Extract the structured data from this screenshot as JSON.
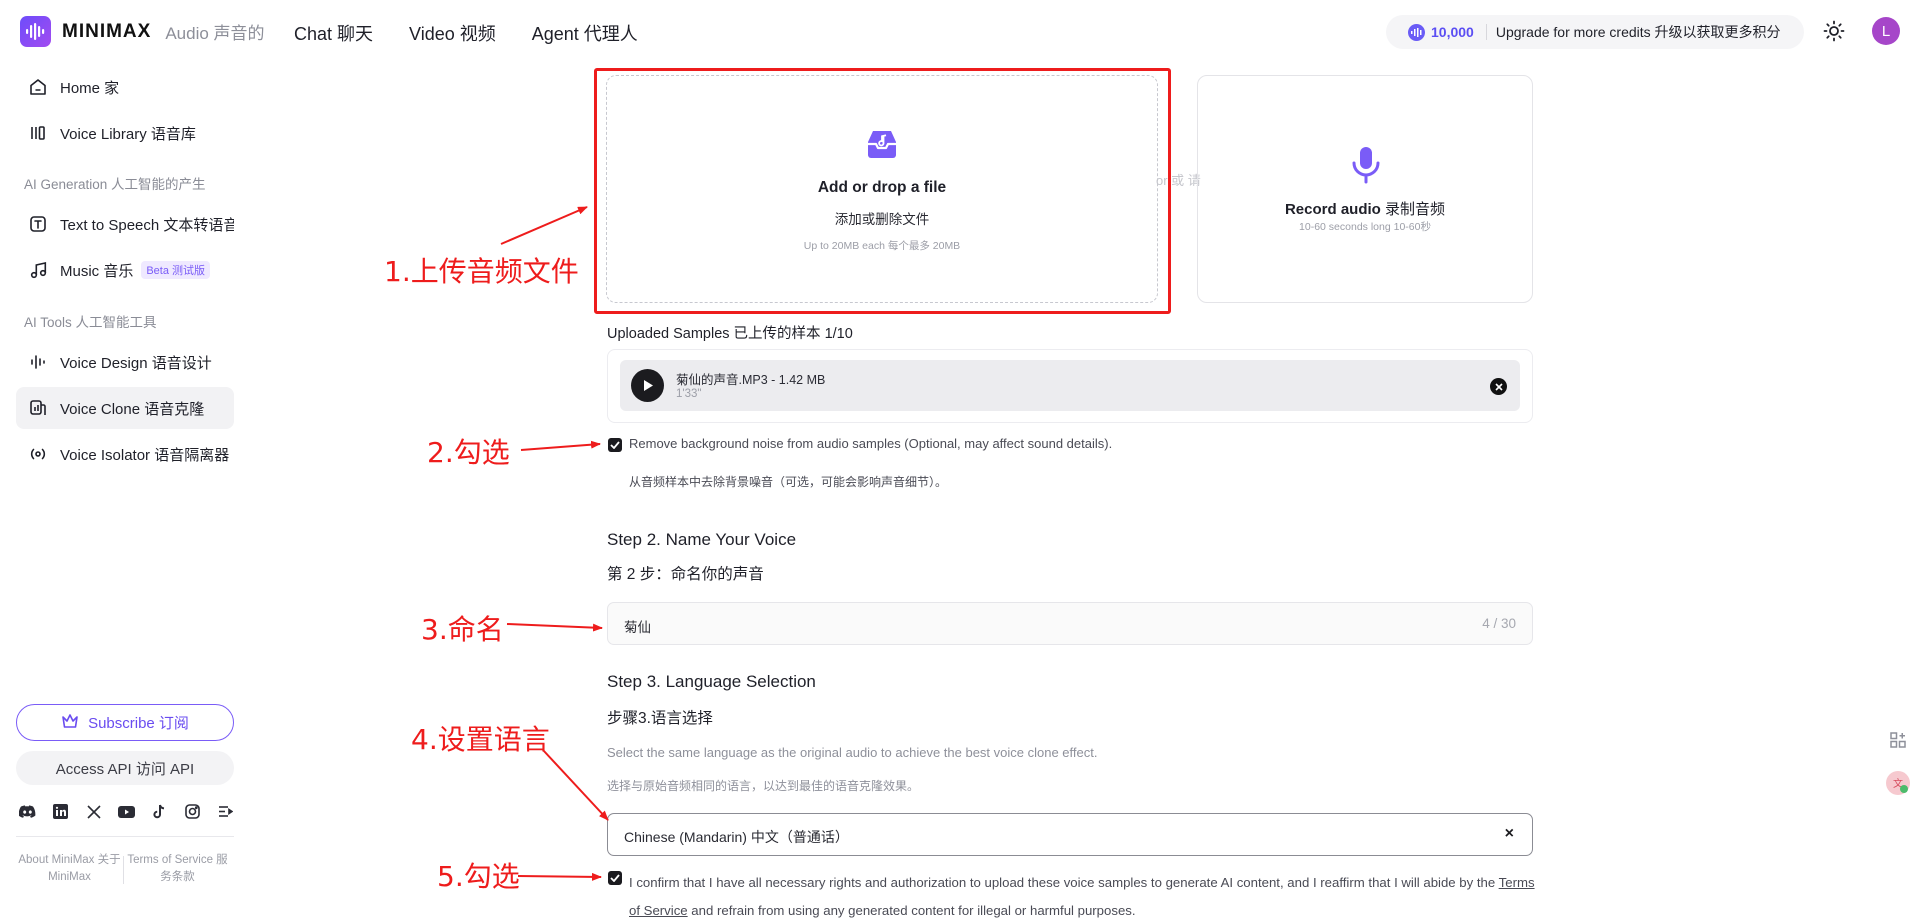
{
  "header": {
    "logo_text": "MINIMAX",
    "logo_sub": "Audio 声音的",
    "nav": [
      "Chat 聊天",
      "Video 视频",
      "Agent 代理人"
    ],
    "credits_value": "10,000",
    "credits_cta": "Upgrade for more credits 升级以获取更多积分",
    "avatar_initial": "L"
  },
  "sidebar": {
    "home": "Home 家",
    "voice_library": "Voice Library 语音库",
    "section_generation": "AI Generation 人工智能的产生",
    "text_to_speech": "Text to Speech 文本转语音",
    "music": "Music 音乐",
    "music_badge": "Beta 测试版",
    "section_tools": "AI Tools 人工智能工具",
    "voice_design": "Voice Design 语音设计",
    "voice_clone": "Voice Clone 语音克隆",
    "voice_isolator": "Voice Isolator 语音隔离器",
    "subscribe": "Subscribe 订阅",
    "access_api": "Access API 访问 API",
    "about": "About MiniMax 关于 MiniMax",
    "terms": "Terms of Service 服务条款"
  },
  "upload": {
    "title": "Add or drop a file",
    "subtitle": "添加或删除文件",
    "hint": "Up to 20MB each 每个最多 20MB",
    "or": "or 或 请",
    "record_title": "Record audio",
    "record_title_cn": "录制音频",
    "record_hint": "10-60 seconds long 10-60秒"
  },
  "samples": {
    "label": "Uploaded Samples 已上传的样本 1/10",
    "file_name": "菊仙的声音.MP3 - 1.42 MB",
    "duration": "1'33\""
  },
  "noise": {
    "label": "Remove background noise from audio samples (Optional, may affect sound details).",
    "label_cn": "从音频样本中去除背景噪音（可选，可能会影响声音细节）。",
    "checked": true
  },
  "step2": {
    "title": "Step 2. Name Your Voice",
    "subtitle": "第 2 步：命名你的声音",
    "value": "菊仙",
    "count": "4 / 30"
  },
  "step3": {
    "title": "Step 3. Language Selection",
    "subtitle": "步骤3.语言选择",
    "hint": "Select the same language as the original audio to achieve the best voice clone effect.",
    "hint_cn": "选择与原始音频相同的语言，以达到最佳的语音克隆效果。",
    "value": "Chinese (Mandarin) 中文（普通话）",
    "clear": "×"
  },
  "confirm": {
    "text_before": "I confirm that I have all necessary rights and authorization to upload these voice samples to generate AI content, and I reaffirm that I will abide by the ",
    "link": "Terms of Service",
    "text_after": " and refrain from using any generated content for illegal or harmful purposes.",
    "checked": true
  },
  "annotations": {
    "a1": "1.上传音频文件",
    "a2": "2.勾选",
    "a3": "3.命名",
    "a4": "4.设置语言",
    "a5": "5.勾选"
  },
  "colors": {
    "brand": "#6d4dfb",
    "annotation_red": "#ee1c1c",
    "accent_purple": "#7a5cf7"
  }
}
